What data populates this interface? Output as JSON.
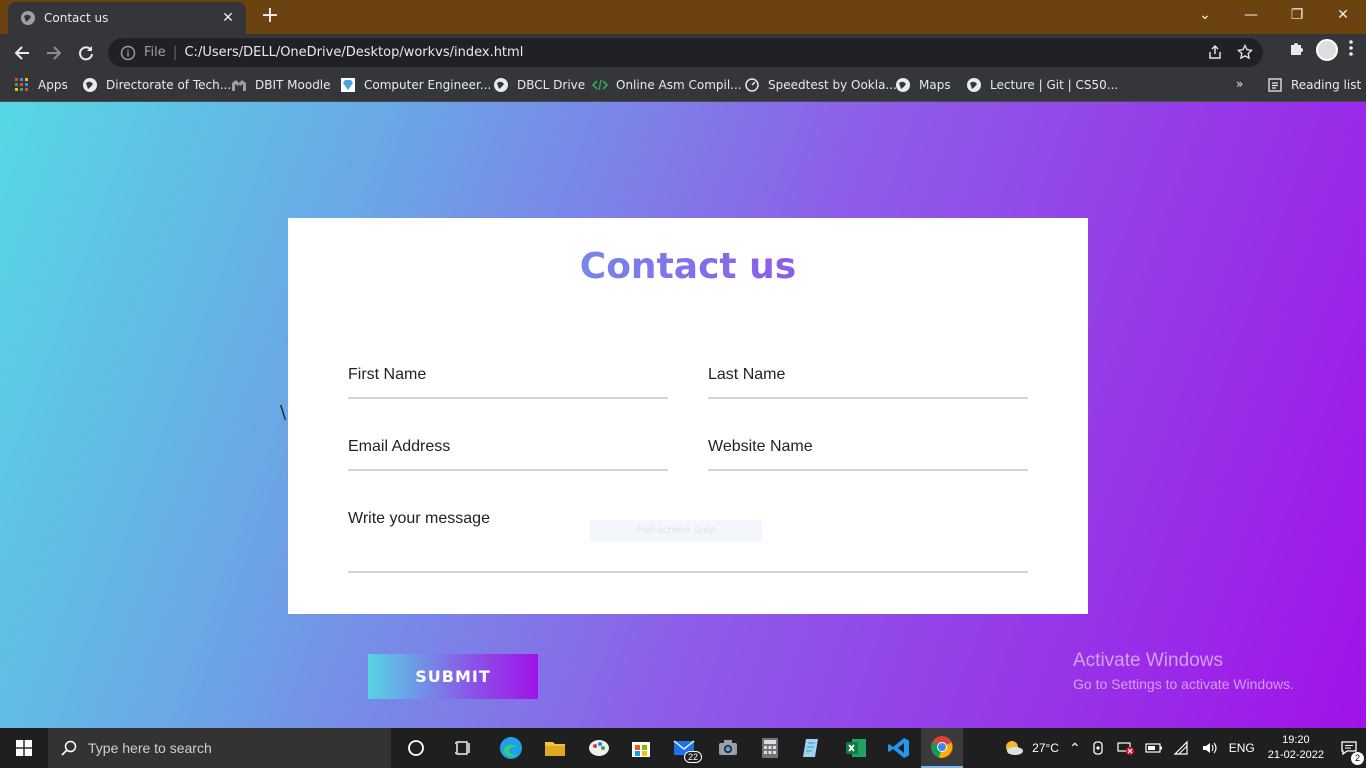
{
  "browser": {
    "tab": {
      "title": "Contact us",
      "close": "✕"
    },
    "new_tab": "+",
    "window_controls": {
      "dropdown": "⌄",
      "minimize": "—",
      "restore": "❐",
      "close": "✕"
    },
    "omnibox": {
      "scheme_label": "File",
      "separator": "|",
      "url": "C:/Users/DELL/OneDrive/Desktop/workvs/index.html"
    },
    "bookmarks": [
      {
        "label": "Apps",
        "icon": "apps-grid-icon"
      },
      {
        "label": "Directorate of Tech...",
        "icon": "globe-icon"
      },
      {
        "label": "DBIT Moodle",
        "icon": "moodle-icon"
      },
      {
        "label": "Computer Engineer...",
        "icon": "diamond-icon"
      },
      {
        "label": "DBCL Drive",
        "icon": "globe-icon"
      },
      {
        "label": "Online Asm Compil...",
        "icon": "code-icon"
      },
      {
        "label": "Speedtest by Ookla...",
        "icon": "speedometer-icon"
      },
      {
        "label": "Maps",
        "icon": "globe-icon"
      },
      {
        "label": "Lecture | Git | CS50...",
        "icon": "globe-icon"
      }
    ],
    "more_bookmarks": "»",
    "reading_list": "Reading list"
  },
  "page": {
    "stray_char": "\\",
    "title": "Contact us",
    "fields": {
      "first_name": "First Name",
      "last_name": "Last Name",
      "email": "Email Address",
      "website": "Website Name",
      "message": "Write your message"
    },
    "snip_overlay": "Full-screen Snip",
    "submit_label": "SUBMIT",
    "activate_title": "Activate Windows",
    "activate_sub": "Go to Settings to activate Windows."
  },
  "taskbar": {
    "search_placeholder": "Type here to search",
    "mail_badge": "22",
    "weather": "27°C",
    "language": "ENG",
    "time": "19:20",
    "date": "21-02-2022",
    "notification_count": "2"
  },
  "colors": {
    "titlebar": "#6b4210",
    "gradient_start": "#56d8e4",
    "gradient_end": "#a012e8"
  }
}
